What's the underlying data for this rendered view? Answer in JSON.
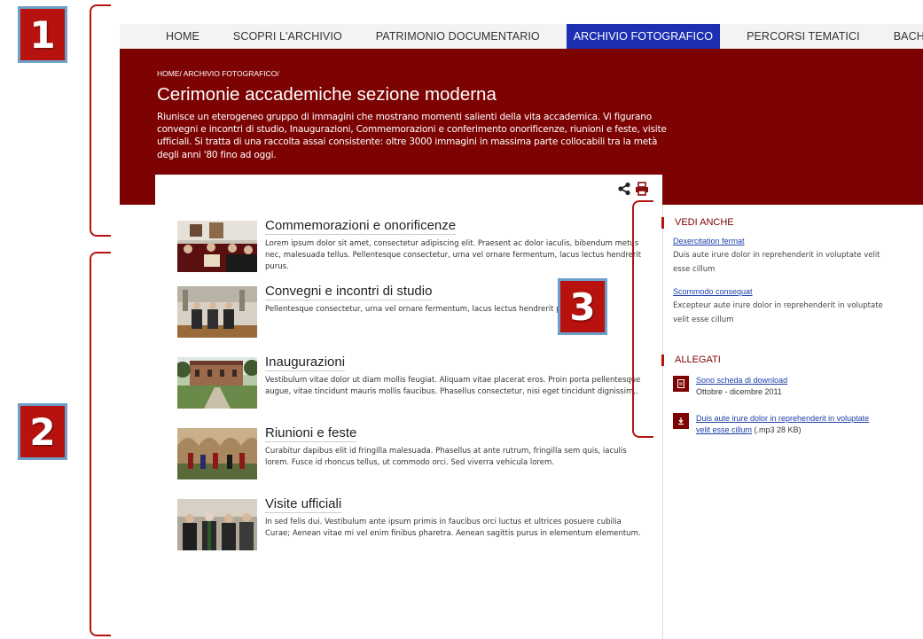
{
  "annotations": {
    "badge1": "1",
    "badge2": "2",
    "badge3": "3"
  },
  "nav": {
    "items": [
      {
        "label": "HOME"
      },
      {
        "label": "SCOPRI L'ARCHIVIO"
      },
      {
        "label": "PATRIMONIO DOCUMENTARIO"
      },
      {
        "label": "ARCHIVIO FOTOGRAFICO"
      },
      {
        "label": "PERCORSI TEMATICI"
      },
      {
        "label": "BACHECA"
      }
    ],
    "active_color": "#1d2fb3"
  },
  "hero": {
    "breadcrumb": "HOME/ ARCHIVIO FOTOGRAFICO/",
    "title": "Cerimonie accademiche sezione moderna",
    "description": "Riunisce un eterogeneo gruppo di immagini che mostrano momenti salienti della vita accademica. Vi figurano convegni e incontri di studio, Inaugurazioni, Commemorazioni e conferimento onorificenze, riunioni e feste, visite ufficiali. Si tratta di una raccolta assai consistente: oltre 3000 immagini in massima parte collocabili tra la metà degli anni '80 fino ad oggi.",
    "background": "#7d0303"
  },
  "toolbar": {
    "share_icon": "share-icon",
    "print_icon": "print-icon"
  },
  "entries": [
    {
      "title": "Commemorazioni e onorificenze",
      "text": "Lorem ipsum dolor sit amet, consectetur adipiscing elit. Praesent ac dolor iaculis, bibendum metus nec, malesuada tellus. Pellentesque consectetur, urna vel ornare fermentum, lacus lectus hendrerit purus."
    },
    {
      "title": "Convegni e incontri di studio",
      "text": "Pellentesque consectetur, urna vel ornare fermentum, lacus lectus hendrerit purus."
    },
    {
      "title": "Inaugurazioni",
      "text": "Vestibulum vitae dolor ut diam mollis feugiat. Aliquam vitae placerat eros. Proin porta pellentesque augue, vitae tincidunt mauris mollis faucibus. Phasellus consectetur, nisi eget tincidunt dignissim,."
    },
    {
      "title": "Riunioni e feste",
      "text": "Curabitur dapibus elit id fringilla malesuada. Phasellus at ante rutrum, fringilla sem quis, iaculis lorem. Fusce id rhoncus tellus, ut commodo orci. Sed viverra vehicula lorem."
    },
    {
      "title": "Visite ufficiali",
      "text": "In sed felis dui. Vestibulum ante ipsum primis in faucibus orci luctus et ultrices posuere cubilia Curae; Aenean vitae mi vel enim finibus pharetra. Aenean sagittis purus in elementum elementum."
    }
  ],
  "sidebar": {
    "see_also_heading": "VEDI ANCHE",
    "see_also": [
      {
        "link": "Dexercitation fermat",
        "text": "Duis aute irure dolor in reprehenderit in voluptate velit esse cillum"
      },
      {
        "link": "Scommodo consequat",
        "text": "Excepteur aute irure dolor in reprehenderit in voluptate velit esse cillum"
      }
    ],
    "attachments_heading": "ALLEGATI",
    "attachments": [
      {
        "icon": "document-icon",
        "link": "Sono scheda di download",
        "sub": "Ottobre - dicembre 2011"
      },
      {
        "icon": "download-icon",
        "link": "Duis aute irure dolor in reprehenderit in voluptate velit esse cillum",
        "note": " (.mp3 28 KB)"
      }
    ]
  }
}
